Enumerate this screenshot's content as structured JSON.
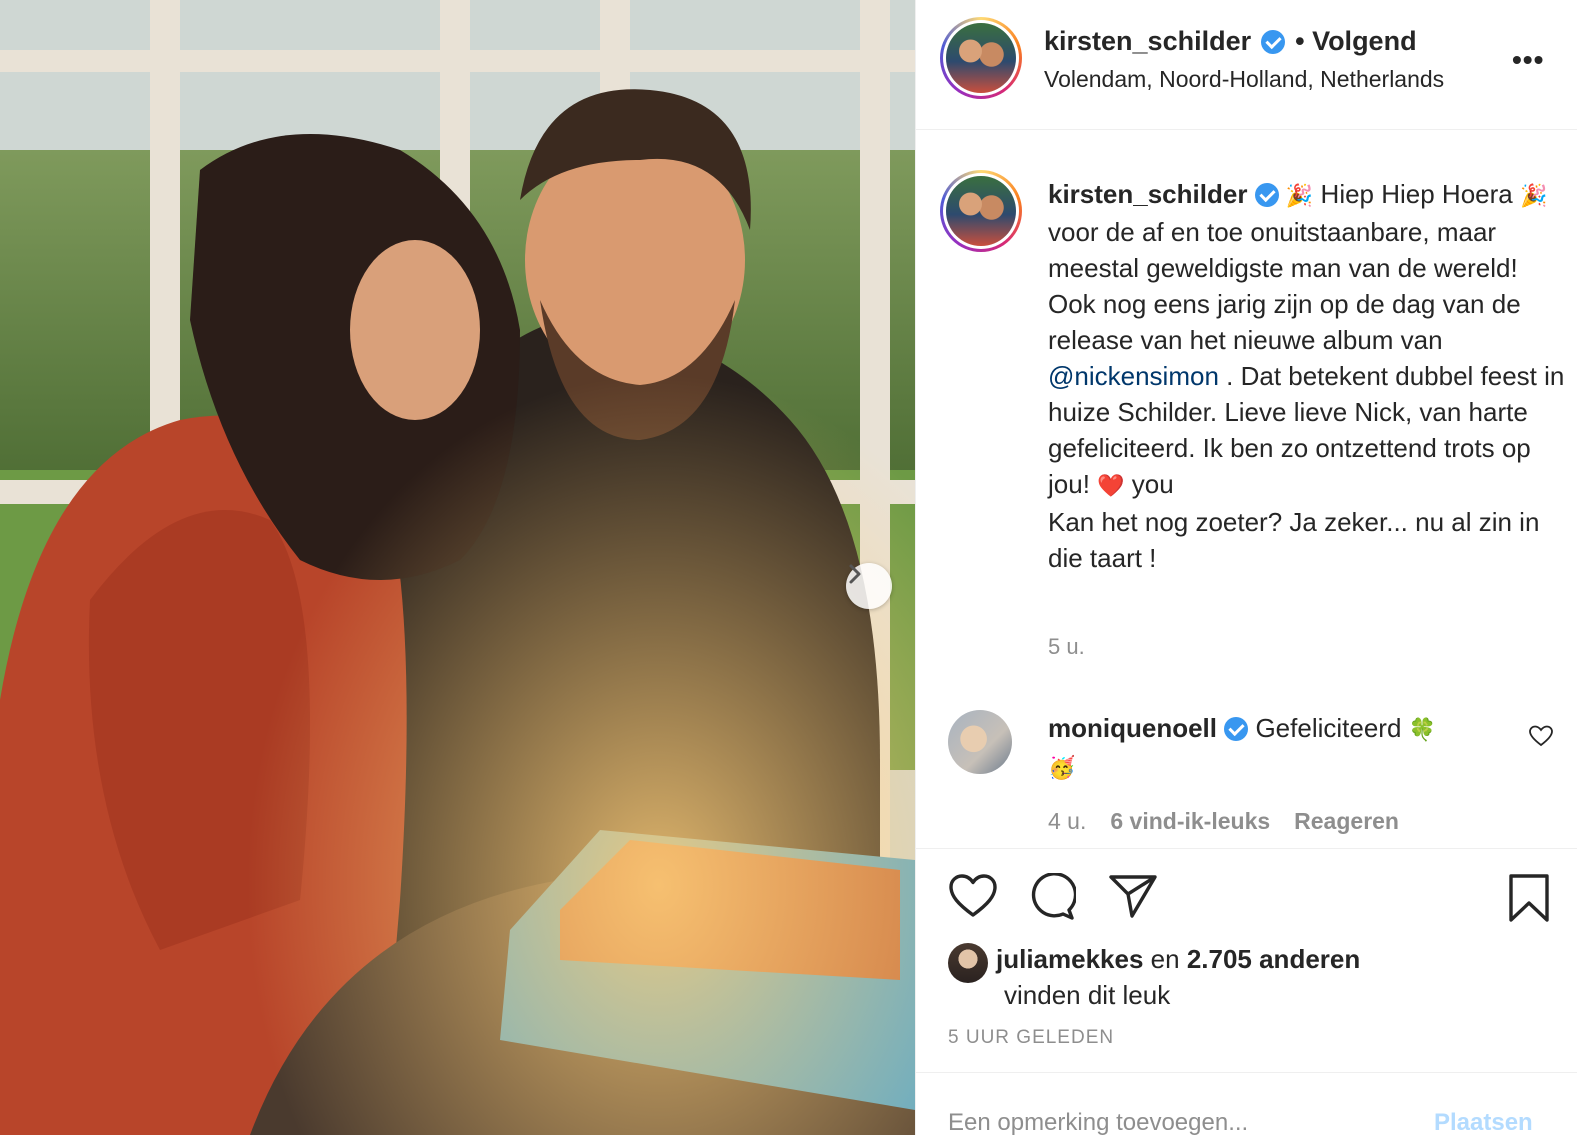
{
  "post": {
    "username": "kirsten_schilder",
    "follow_status": "• Volgend",
    "location": "Volendam, Noord-Holland, Netherlands",
    "more_label": "•••"
  },
  "caption": {
    "username": "kirsten_schilder",
    "emoji_party": "🎉",
    "text_1": " Hiep Hiep Hoera ",
    "text_2": "  voor de af en toe onuitstaanbare, maar meestal geweldigste man van de wereld! Ook nog eens jarig zijn op de dag van de release van het nieuwe album van ",
    "mention": "@nickensimon",
    "text_3": " . Dat betekent dubbel feest in huize Schilder. Lieve lieve Nick, van harte gefeliciteerd. Ik ben zo ontzettend trots op jou! ",
    "emoji_heart": "❤️",
    "text_4": " you",
    "text_5": "Kan het nog zoeter? Ja zeker... nu al zin in die taart !",
    "time": "5 u."
  },
  "comment": {
    "username": "moniquenoell",
    "text": " Gefeliciteerd ",
    "emoji_clover": "🍀",
    "emoji_face": "🥳",
    "time": "4 u.",
    "likes": "6 vind-ik-leuks",
    "reply": "Reageren"
  },
  "likes": {
    "user": "juliamekkes",
    "connector": " en ",
    "count": "2.705 anderen",
    "suffix": "vinden dit leuk"
  },
  "posted_ago": "5 UUR GELEDEN",
  "add_comment": {
    "placeholder": "Een opmerking toevoegen...",
    "post_label": "Plaatsen"
  },
  "icons": [
    "heart-icon",
    "comment-icon",
    "share-icon",
    "bookmark-icon",
    "verified-icon",
    "chevron-right-icon"
  ],
  "colors": {
    "verified": "#3897f0",
    "mention": "#00376b",
    "muted": "#8e8e8e",
    "post_button": "#b3dbff"
  }
}
